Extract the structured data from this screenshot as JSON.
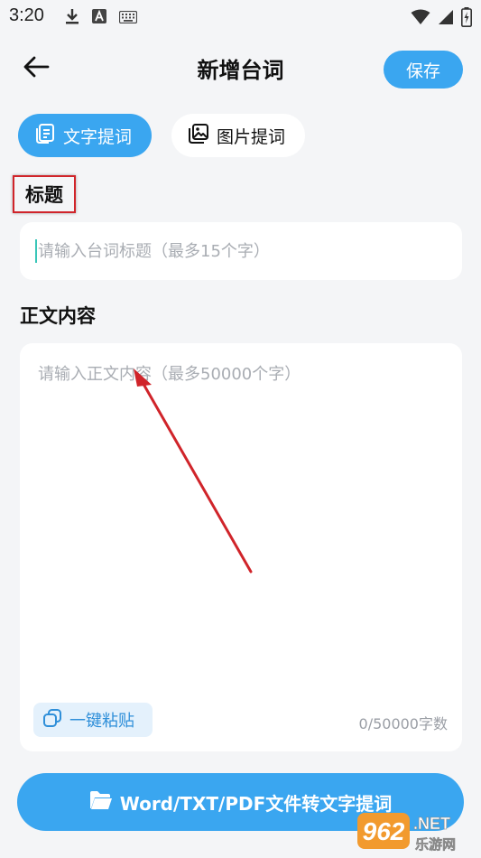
{
  "status_bar": {
    "time": "3:20",
    "left_icons": [
      "download-icon",
      "text-a-icon",
      "keyboard-icon"
    ],
    "right_icons": [
      "wifi-icon",
      "signal-icon",
      "battery-charging-icon"
    ]
  },
  "header": {
    "title": "新增台词",
    "save_label": "保存",
    "back_icon": "arrow-left-icon"
  },
  "tabs": [
    {
      "label": "文字提词",
      "icon": "document-icon",
      "active": true
    },
    {
      "label": "图片提词",
      "icon": "image-icon",
      "active": false
    }
  ],
  "form": {
    "title_label": "标题",
    "title_placeholder": "请输入台词标题（最多15个字）",
    "title_value": "",
    "body_label": "正文内容",
    "body_placeholder": "请输入正文内容（最多50000个字）",
    "body_value": "",
    "paste_label": "一键粘贴",
    "char_count": "0/50000字数"
  },
  "bottom_action": {
    "label": "Word/TXT/PDF文件转文字提词",
    "icon": "folder-icon"
  },
  "watermark": {
    "brand": "962",
    "suffix": ".NET",
    "sub": "乐游网"
  },
  "colors": {
    "accent": "#3aa6f0",
    "background": "#f4f5f7",
    "annotation": "#d0242a"
  }
}
